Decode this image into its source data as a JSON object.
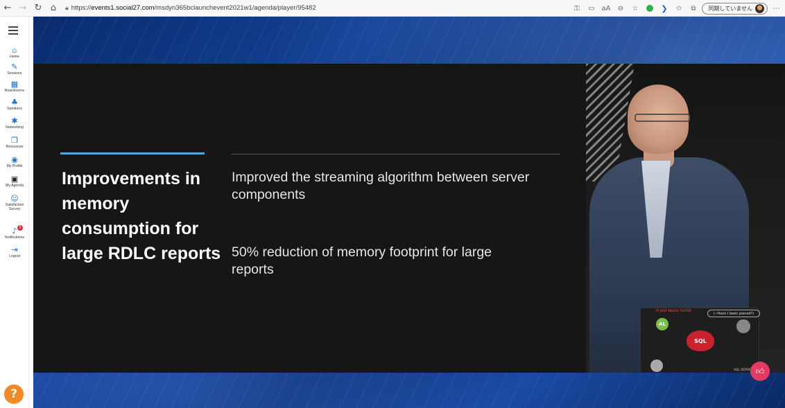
{
  "browser": {
    "url_prefix": "https://",
    "url_host": "events1.social27.com",
    "url_path": "/msdyn365bclaunchevent2021w1/agenda/player/95482",
    "sync_label": "同期していません"
  },
  "sidebar": {
    "items": [
      {
        "label": "Home",
        "icon": "home-icon"
      },
      {
        "label": "Sessions",
        "icon": "pencil-icon"
      },
      {
        "label": "Boardrooms",
        "icon": "boardroom-icon"
      },
      {
        "label": "Speakers",
        "icon": "speaker-icon"
      },
      {
        "label": "Networking",
        "icon": "networking-icon"
      },
      {
        "label": "Resources",
        "icon": "resources-icon"
      },
      {
        "label": "My Profile",
        "icon": "profile-icon"
      },
      {
        "label": "My Agenda",
        "icon": "calendar-icon"
      },
      {
        "label": "Satisfaction Survey",
        "icon": "survey-icon"
      },
      {
        "label": "Notifications",
        "icon": "bell-icon",
        "badge": "5"
      },
      {
        "label": "Logout",
        "icon": "logout-icon"
      }
    ],
    "help_label": "?"
  },
  "slide": {
    "title": "Improvements in memory consumption for large RDLC reports",
    "bullets": [
      "Improved the streaming algorithm between server components",
      "50% reduction of memory footprint for large reports"
    ]
  },
  "camera": {
    "laptop_tag": "(--Have I been pwned?)",
    "sticker_al": "AL",
    "sticker_sql": "SQL",
    "laptop_brand": "SQL SERVER",
    "laptop_note": "IT JUST NEEDS TESTED"
  },
  "colors": {
    "accent_line": "#4ea8de",
    "like_button": "#e33b63",
    "help_button": "#f08a24",
    "sidebar_icon": "#1c6fc7"
  }
}
